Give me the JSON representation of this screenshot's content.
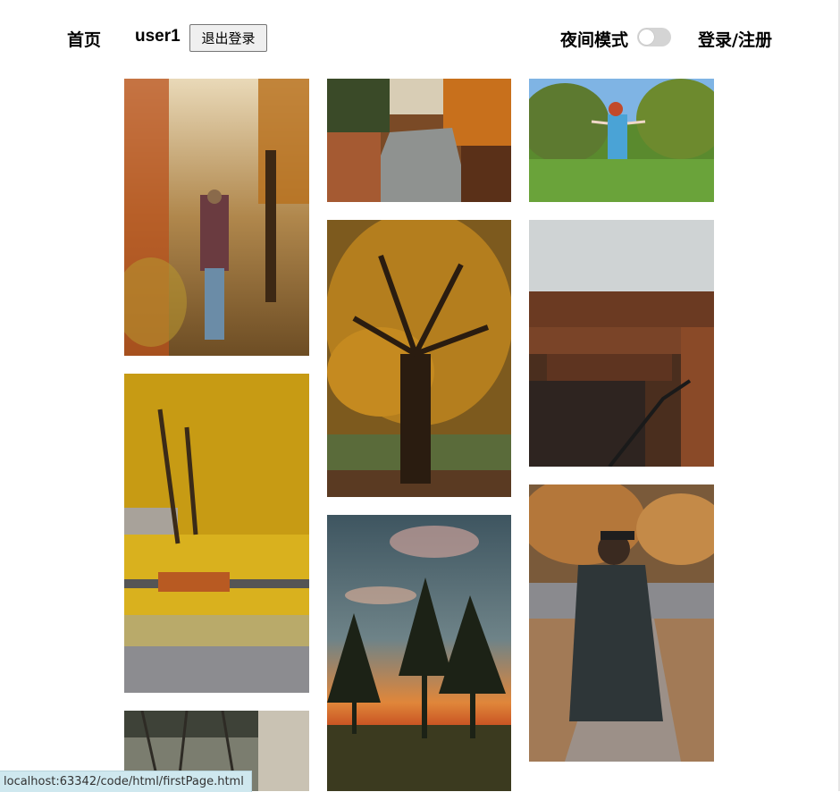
{
  "header": {
    "home": "首页",
    "username": "user1",
    "logout": "退出登录",
    "night_mode": "夜间模式",
    "login_register": "登录/注册"
  },
  "status_bar": {
    "url": "localhost:63342/code/html/firstPage.html"
  },
  "gallery": {
    "columns": 3,
    "photos": [
      {
        "subject": "man-in-autumn-park"
      },
      {
        "subject": "autumn-river"
      },
      {
        "subject": "girl-dancing-in-orchard"
      },
      {
        "subject": "large-autumn-tree"
      },
      {
        "subject": "circular-library"
      },
      {
        "subject": "yellow-tree-with-bench"
      },
      {
        "subject": "graduate-walking-path"
      },
      {
        "subject": "pine-trees-at-sunset"
      },
      {
        "subject": "forest-trees"
      }
    ]
  },
  "colors": {
    "background": "#ffffff",
    "toggle_off": "#d4d4d4",
    "status_bar_bg": "#cfe8ef"
  }
}
